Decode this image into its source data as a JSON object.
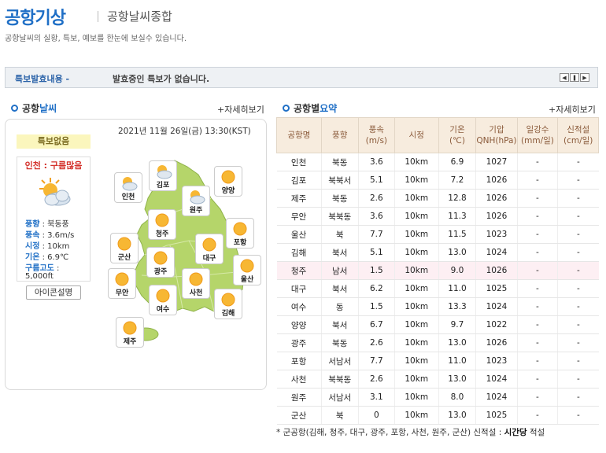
{
  "header": {
    "title": "공항기상",
    "subtitle": "공항날씨종합",
    "description": "공항날씨의 실황, 특보, 예보를 한눈에 보실수 있습니다."
  },
  "alert": {
    "label": "특보발효내용 -",
    "text": "발효중인 특보가 없습니다."
  },
  "left": {
    "heading_a": "공항",
    "heading_b": "날씨",
    "more": "+자세히보기",
    "time": "2021년 11월 26일(금) 13:30(KST)",
    "badge": "특보없음",
    "card_title": "인천 : 구름많음",
    "wind_dir_label": "풍향",
    "wind_dir": "북동풍",
    "wind_speed_label": "풍속",
    "wind_speed": "3.6m/s",
    "visibility_label": "시정",
    "visibility": "10km",
    "temp_label": "기온",
    "temp": "6.9℃",
    "cloud_label": "구름고도",
    "cloud": "5,000ft",
    "icon_button": "아이콘설명",
    "map_labels": [
      "인천",
      "김포",
      "원주",
      "양양",
      "청주",
      "포항",
      "군산",
      "대구",
      "광주",
      "울산",
      "무안",
      "사천",
      "여수",
      "김해",
      "제주"
    ]
  },
  "right": {
    "heading_a": "공항별",
    "heading_b": "요약",
    "more": "+자세히보기",
    "columns": [
      "공항명",
      "풍향",
      "풍속(m/s)",
      "시정",
      "기온(℃)",
      "기압QNH(hPa)",
      "일강수(mm/일)",
      "신적설(cm/일)"
    ],
    "col_top": [
      "공항명",
      "풍향",
      "풍속",
      "시정",
      "기온",
      "기압",
      "일강수",
      "신적설"
    ],
    "col_bottom": [
      "",
      "",
      "(m/s)",
      "",
      "(℃)",
      "QNH(hPa)",
      "(mm/일)",
      "(cm/일)"
    ],
    "rows": [
      [
        "인천",
        "북동",
        "3.6",
        "10km",
        "6.9",
        "1027",
        "-",
        "-"
      ],
      [
        "김포",
        "북북서",
        "5.1",
        "10km",
        "7.2",
        "1026",
        "-",
        "-"
      ],
      [
        "제주",
        "북동",
        "2.6",
        "10km",
        "12.8",
        "1026",
        "-",
        "-"
      ],
      [
        "무안",
        "북북동",
        "3.6",
        "10km",
        "11.3",
        "1026",
        "-",
        "-"
      ],
      [
        "울산",
        "북",
        "7.7",
        "10km",
        "11.5",
        "1023",
        "-",
        "-"
      ],
      [
        "김해",
        "북서",
        "5.1",
        "10km",
        "13.0",
        "1024",
        "-",
        "-"
      ],
      [
        "청주",
        "남서",
        "1.5",
        "10km",
        "9.0",
        "1026",
        "-",
        "-"
      ],
      [
        "대구",
        "북서",
        "6.2",
        "10km",
        "11.0",
        "1025",
        "-",
        "-"
      ],
      [
        "여수",
        "동",
        "1.5",
        "10km",
        "13.3",
        "1024",
        "-",
        "-"
      ],
      [
        "양양",
        "북서",
        "6.7",
        "10km",
        "9.7",
        "1022",
        "-",
        "-"
      ],
      [
        "광주",
        "북동",
        "2.6",
        "10km",
        "13.0",
        "1026",
        "-",
        "-"
      ],
      [
        "포항",
        "서남서",
        "7.7",
        "10km",
        "11.0",
        "1023",
        "-",
        "-"
      ],
      [
        "사천",
        "북북동",
        "2.6",
        "10km",
        "13.0",
        "1024",
        "-",
        "-"
      ],
      [
        "원주",
        "서남서",
        "3.1",
        "10km",
        "8.0",
        "1024",
        "-",
        "-"
      ],
      [
        "군산",
        "북",
        "0",
        "10km",
        "13.0",
        "1025",
        "-",
        "-"
      ]
    ],
    "footnote_a": "* 군공항(김해, 청주, 대구, 광주, 포항, 사천, 원주, 군산) 신적설 : ",
    "footnote_b": "시간당",
    "footnote_c": " 적설"
  },
  "colors": {
    "accent": "#1f6fc6",
    "alert_red": "#d4322c",
    "map_green": "#b5d56a",
    "table_head": "#f7ecde",
    "highlight_row": "#fdeff3"
  }
}
